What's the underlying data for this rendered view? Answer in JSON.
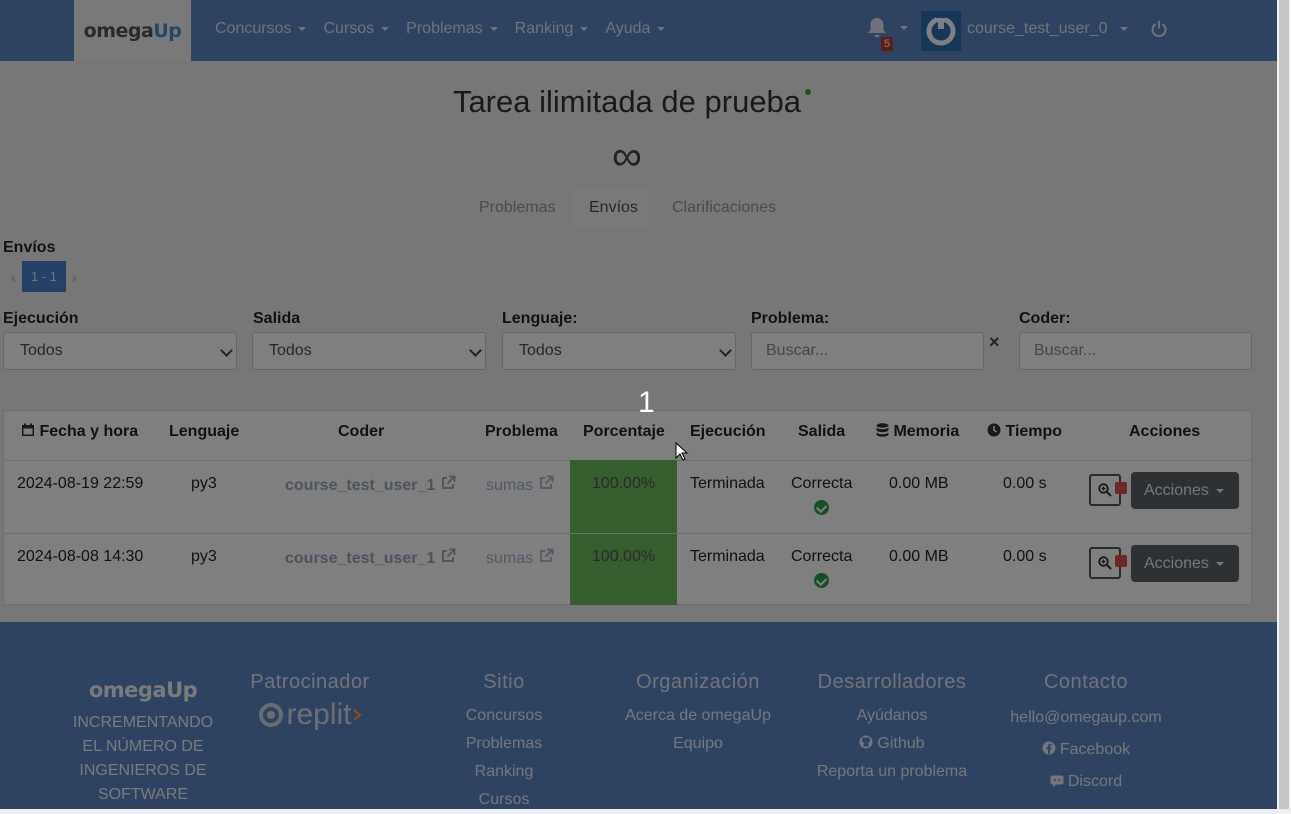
{
  "navbar": {
    "brand": {
      "part1": "omega",
      "part2": "Up"
    },
    "menu": [
      "Concursos",
      "Cursos",
      "Problemas",
      "Ranking",
      "Ayuda"
    ],
    "notification_count": "5",
    "username": "course_test_user_0"
  },
  "header": {
    "title": "Tarea ilimitada de prueba",
    "time_symbol": "∞"
  },
  "tabs": [
    "Problemas",
    "Envíos",
    "Clarificaciones"
  ],
  "submissions": {
    "label": "Envíos",
    "pager": {
      "prev": "‹",
      "current": "1 - 1",
      "next": "›"
    }
  },
  "filters": {
    "ejecucion": {
      "label": "Ejecución",
      "value": "Todos"
    },
    "salida": {
      "label": "Salida",
      "value": "Todos"
    },
    "lenguaje": {
      "label": "Lenguaje:",
      "value": "Todos"
    },
    "problema": {
      "label": "Problema:",
      "placeholder": "Buscar..."
    },
    "coder": {
      "label": "Coder:",
      "placeholder": "Buscar..."
    },
    "clear": "×"
  },
  "step_marker": "1",
  "table": {
    "headers": [
      "Fecha y hora",
      "Lenguaje",
      "Coder",
      "Problema",
      "Porcentaje",
      "Ejecución",
      "Salida",
      "Memoria",
      "Tiempo",
      "Acciones"
    ],
    "rows": [
      {
        "date": "2024-08-19 22:59",
        "language": "py3",
        "coder": "course_test_user_1",
        "problem": "sumas",
        "percent": "100.00%",
        "status": "Terminada",
        "output": "Correcta",
        "memory": "0.00 MB",
        "time": "0.00 s",
        "actions": "Acciones"
      },
      {
        "date": "2024-08-08 14:30",
        "language": "py3",
        "coder": "course_test_user_1",
        "problem": "sumas",
        "percent": "100.00%",
        "status": "Terminada",
        "output": "Correcta",
        "memory": "0.00 MB",
        "time": "0.00 s",
        "actions": "Acciones"
      }
    ]
  },
  "footer": {
    "slogan": [
      "INCREMENTANDO",
      "EL NÚMERO DE",
      "INGENIEROS DE",
      "SOFTWARE"
    ],
    "sponsor": {
      "heading": "Patrocinador",
      "name": "replit"
    },
    "sitio": {
      "heading": "Sitio",
      "links": [
        "Concursos",
        "Problemas",
        "Ranking",
        "Cursos"
      ]
    },
    "organizacion": {
      "heading": "Organización",
      "links": [
        "Acerca de omegaUp",
        "Equipo"
      ]
    },
    "desarrolladores": {
      "heading": "Desarrolladores",
      "links": [
        "Ayúdanos",
        "Github",
        "Reporta un problema"
      ]
    },
    "contacto": {
      "heading": "Contacto",
      "links": [
        "hello@omegaup.com",
        "Facebook",
        "Discord"
      ]
    }
  },
  "colors": {
    "navbar": "#5d86c2",
    "success": "#6dbb5c",
    "overlay": "rgba(0,0,0,0.5)"
  }
}
